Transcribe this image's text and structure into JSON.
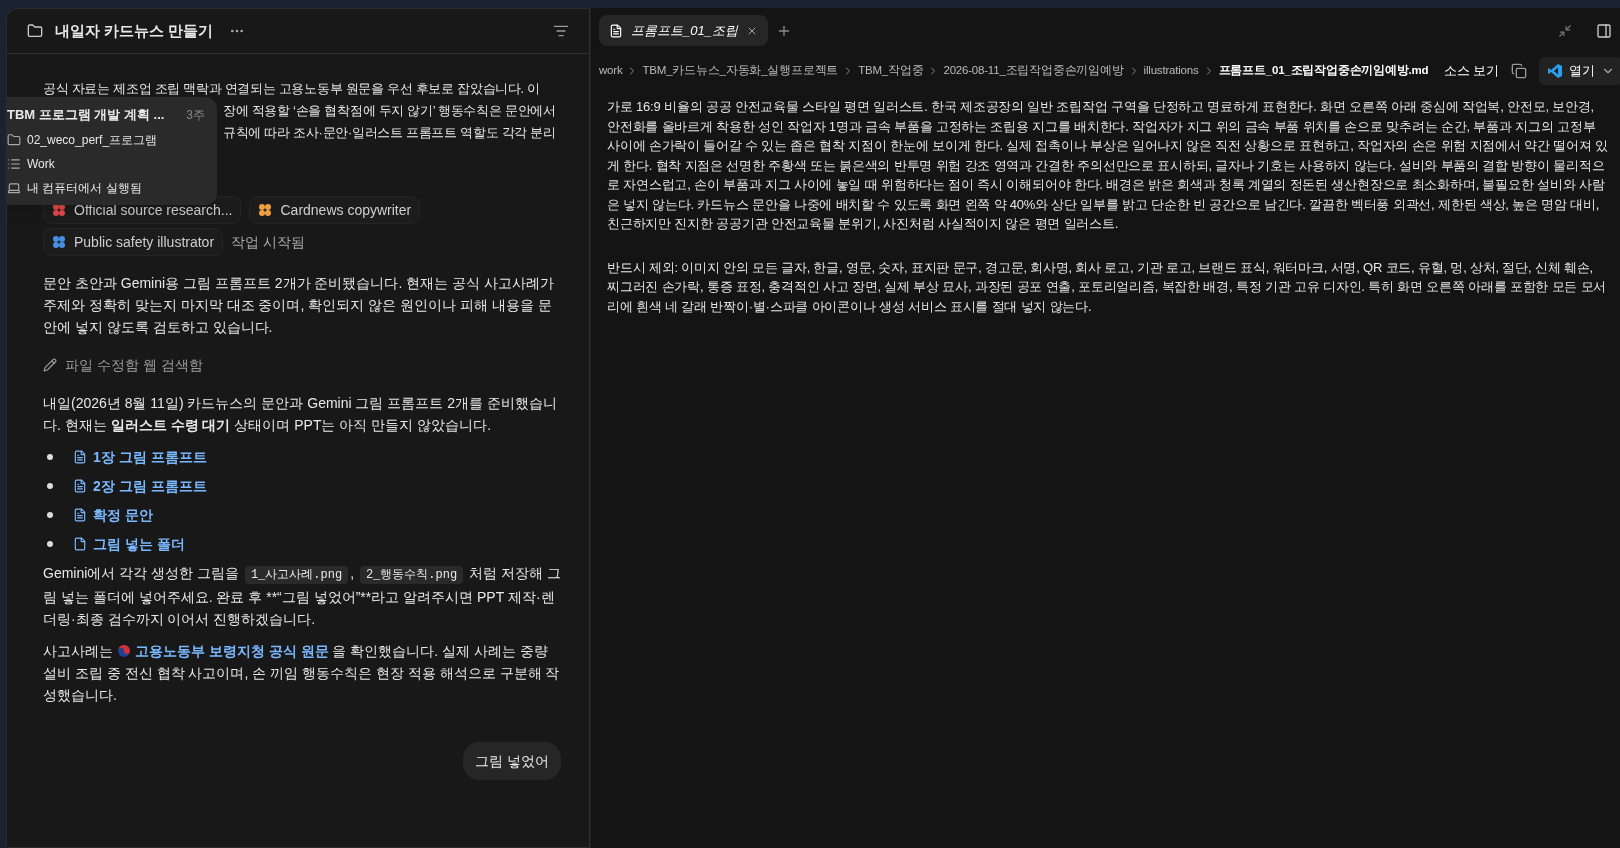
{
  "chat": {
    "title": "내일자 카드뉴스 만들기",
    "intro_lines": [
      "공식 자료는 제조업 조립 맥락과 연결되는 고용노동부 원문을 우선 후보로 잡았습니다. 이",
      "장에 적용할 ‘손을 협착점에 두지 않기’ 행동수칙은 문안에서",
      "규칙에 따라 조사·문안·일러스트 프롬프트 역할도 각각 분리"
    ],
    "agents": [
      {
        "label": "Official source research...",
        "color": "#e04848"
      },
      {
        "label": "Cardnews copywriter",
        "color": "#f0a040"
      },
      {
        "label": "Public safety illustrator",
        "color": "#4a90e2"
      }
    ],
    "agents_status": "작업 시작됨",
    "paragraph_1": "문안 초안과 Gemini용 그림 프롬프트 2개가 준비됐습니다. 현재는 공식 사고사례가 주제와 정확히 맞는지 마지막 대조 중이며, 확인되지 않은 원인이나 피해 내용을 문안에 넣지 않도록 검토하고 있습니다.",
    "activity": "파일 수정함 웹 검색함",
    "paragraph_2": "내일(2026년 8월 11일) 카드뉴스의 문안과 Gemini 그림 프롬프트 2개를 준비했습니다. 현재는 **일러스트 수령 대기** 상태이며 PPT는 아직 만들지 않았습니다.",
    "links": [
      {
        "kind": "doc",
        "label": "1장 그림 프롬프트"
      },
      {
        "kind": "doc",
        "label": "2장 그림 프롬프트"
      },
      {
        "kind": "doc",
        "label": "확정 문안"
      },
      {
        "kind": "folder",
        "label": "그림 넣는 폴더"
      }
    ],
    "paragraph_3": [
      {
        "kind": "text",
        "text": "Gemini에서 각각 생성한 그림을 "
      },
      {
        "kind": "code",
        "text": "1_사고사례.png"
      },
      {
        "kind": "text",
        "text": ", "
      },
      {
        "kind": "code",
        "text": "2_행동수칙.png"
      },
      {
        "kind": "text",
        "text": " 처럼 저장해 그림 넣는 폴더에 넣어주세요. 완료 후 **“그림 넣었어”**라고 알려주시면 PPT 제작·렌더링·최종 검수까지 이어서 진행하겠습니다."
      }
    ],
    "paragraph_4": [
      {
        "kind": "text",
        "text": "사고사례는 "
      },
      {
        "kind": "link",
        "text": "고용노동부 보령지청 공식 원문"
      },
      {
        "kind": "text",
        "text": " 을 확인했습니다. 실제 사례는 중량 설비 조립 중 전신 협착 사고이며, 손 끼임 행동수칙은 현장 적용 해석으로 구분해 작성했습니다."
      }
    ],
    "user_message": "그림 넣었어"
  },
  "popup": {
    "title": "TBM 프로그램 개발 계획 ...",
    "age": "3주",
    "items": [
      {
        "kind": "folder",
        "label": "02_weco_perf_프로그램"
      },
      {
        "kind": "list",
        "label": "Work"
      },
      {
        "kind": "computer",
        "label": "내 컴퓨터에서 실행됨"
      }
    ]
  },
  "editor": {
    "tabs": [
      {
        "label": "프롬프트_01_조립",
        "selected": true
      }
    ],
    "breadcrumb": [
      "work",
      "TBM_카드뉴스_자동화_실행프로젝트",
      "TBM_작업중",
      "2026-08-11_조립작업중손끼임예방",
      "illustrations",
      "프롬프트_01_조립작업중손끼임예방.md"
    ],
    "source_view": "소스 보기",
    "open_button": "열기",
    "paragraphs": [
      "가로 16:9 비율의 공공 안전교육물 스타일 평면 일러스트. 한국 제조공장의 일반 조립작업 구역을 단정하고 명료하게 표현한다. 화면 오른쪽 아래 중심에 작업복, 안전모, 보안경, 안전화를 올바르게 착용한 성인 작업자 1명과 금속 부품을 고정하는 조립용 지그를 배치한다. 작업자가 지그 위의 금속 부품 위치를 손으로 맞추려는 순간, 부품과 지그의 고정부 사이에 손가락이 들어갈 수 있는 좁은 협착 지점이 한눈에 보이게 한다. 실제 접촉이나 부상은 일어나지 않은 직전 상황으로 표현하고, 작업자의 손은 위험 지점에서 약간 떨어져 있게 한다. 협착 지점은 선명한 주황색 또는 붉은색의 반투명 위험 강조 영역과 간결한 주의선만으로 표시하되, 글자나 기호는 사용하지 않는다. 설비와 부품의 결합 방향이 물리적으로 자연스럽고, 손이 부품과 지그 사이에 놓일 때 위험하다는 점이 즉시 이해되어야 한다. 배경은 밝은 회색과 청록 계열의 정돈된 생산현장으로 최소화하며, 불필요한 설비와 사람은 넣지 않는다. 카드뉴스 문안을 나중에 배치할 수 있도록 화면 왼쪽 약 40%와 상단 일부를 밝고 단순한 빈 공간으로 남긴다. 깔끔한 벡터풍 외곽선, 제한된 색상, 높은 명암 대비, 친근하지만 진지한 공공기관 안전교육물 분위기, 사진처럼 사실적이지 않은 평면 일러스트.",
      "반드시 제외: 이미지 안의 모든 글자, 한글, 영문, 숫자, 표지판 문구, 경고문, 회사명, 회사 로고, 기관 로고, 브랜드 표식, 워터마크, 서명, QR 코드, 유혈, 멍, 상처, 절단, 신체 훼손, 찌그러진 손가락, 통증 표정, 충격적인 사고 장면, 실제 부상 묘사, 과장된 공포 연출, 포토리얼리즘, 복잡한 배경, 특정 기관 고유 디자인. 특히 화면 오른쪽 아래를 포함한 모든 모서리에 흰색 네 갈래 반짝이·별·스파클 아이콘이나 생성 서비스 표시를 절대 넣지 않는다."
    ]
  }
}
